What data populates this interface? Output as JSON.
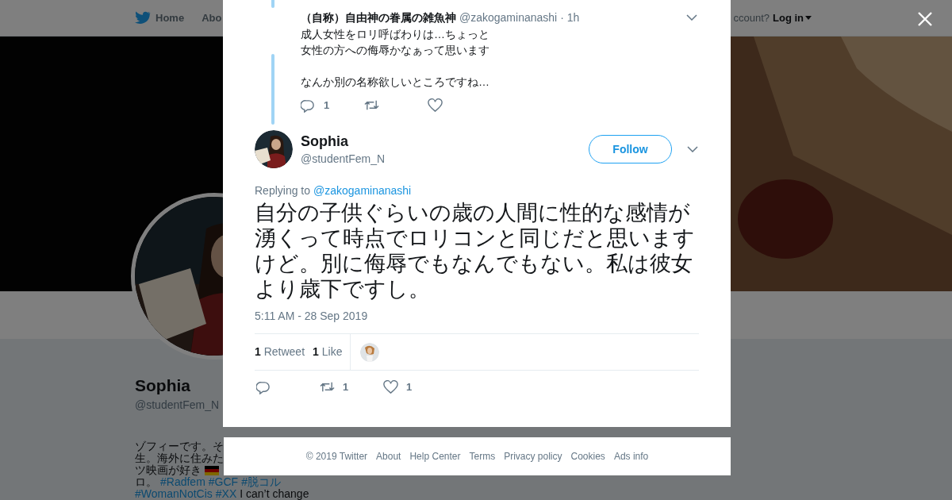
{
  "nav": {
    "items": [
      {
        "label": "Home",
        "kind": "home"
      },
      {
        "label": "Abo",
        "kind": "plain"
      }
    ],
    "account_prompt": "ccount?",
    "login": "Log in"
  },
  "profile": {
    "name": "Sophia",
    "handle": "@studentFem_N",
    "bio_lines": [
      [
        {
          "kind": "text",
          "text": "ゾフィーです。そ"
        }
      ],
      [
        {
          "kind": "text",
          "text": "生。海外に住みた"
        }
      ],
      [
        {
          "kind": "text",
          "text": "ツ映画が好き"
        },
        {
          "kind": "flag"
        }
      ],
      [
        {
          "kind": "text",
          "text": "ロ。"
        },
        {
          "kind": "hashtag",
          "text": "#Radfem"
        },
        {
          "kind": "hashtag",
          "text": "#GCF"
        },
        {
          "kind": "hashtag",
          "text": "#脱コル"
        }
      ],
      [
        {
          "kind": "hashtag",
          "text": "#WomanNotCis"
        },
        {
          "kind": "hashtag",
          "text": "#XX"
        },
        {
          "kind": "text",
          "text": "I can’t change"
        }
      ]
    ]
  },
  "dialog": {
    "parent_tweet": {
      "name": "（自称）自由神の眷属の雑魚神",
      "handle": "@zakogaminanashi",
      "time": "· 1h",
      "paragraphs": [
        [
          "成人女性をロリ呼ばわりは…ちょっと",
          "女性の方への侮辱かなぁって思います"
        ],
        [
          "なんか別の名称欲しいところですね…"
        ]
      ],
      "actions": [
        {
          "kind": "reply",
          "count": "1"
        },
        {
          "kind": "retweet"
        },
        {
          "kind": "like"
        }
      ]
    },
    "tweet": {
      "name": "Sophia",
      "handle": "@studentFem_N",
      "follow": "Follow",
      "replying_to": "Replying to",
      "reply_handle": "@zakogaminanashi",
      "text": "自分の子供ぐらいの歳の人間に性的な感情が湧くって時点でロリコンと同じだと思いますけど。別に侮辱でもなんでもない。私は彼女より歳下ですし。",
      "timestamp": "5:11 AM - 28 Sep 2019",
      "stats": [
        {
          "count": "1",
          "label": "Retweet"
        },
        {
          "count": "1",
          "label": "Like"
        }
      ],
      "actions": [
        {
          "kind": "reply"
        },
        {
          "kind": "retweet",
          "count": "1"
        },
        {
          "kind": "like",
          "count": "1"
        }
      ]
    }
  },
  "footer": {
    "links": [
      "© 2019 Twitter",
      "About",
      "Help Center",
      "Terms",
      "Privacy policy",
      "Cookies",
      "Ads info"
    ]
  }
}
